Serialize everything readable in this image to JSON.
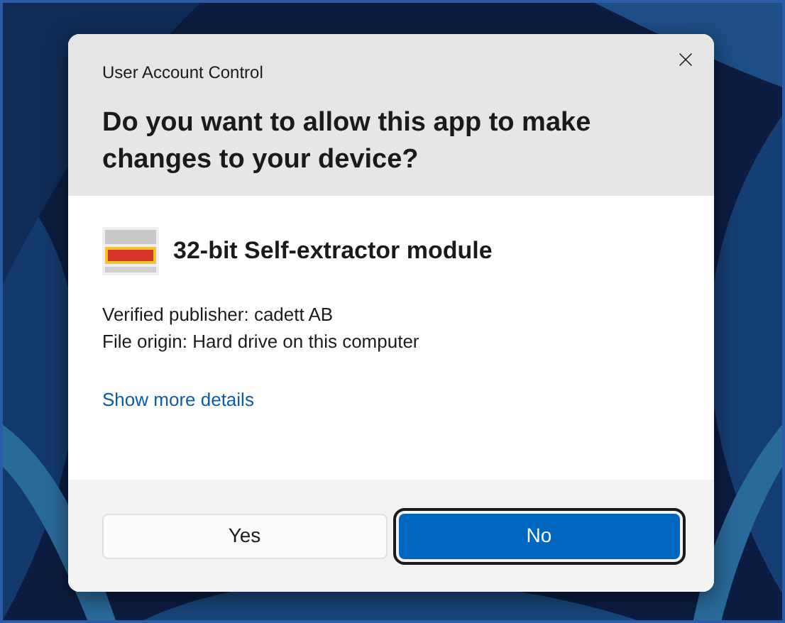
{
  "dialog": {
    "title": "User Account Control",
    "question": "Do you want to allow this app to make changes to your device?",
    "app_name": "32-bit Self-extractor module",
    "details": [
      "Verified publisher: cadett AB",
      "File origin: Hard drive on this computer"
    ],
    "more_link": "Show more details"
  },
  "buttons": [
    {
      "label": "Yes",
      "focused": false
    },
    {
      "label": "No",
      "focused": true
    }
  ]
}
